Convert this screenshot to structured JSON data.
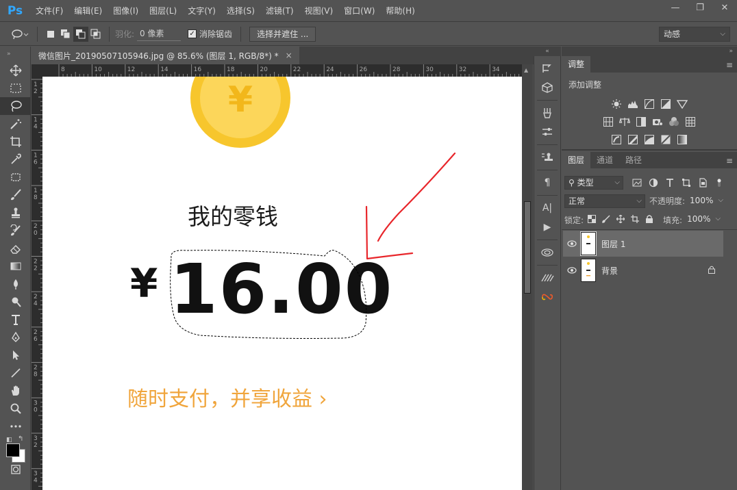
{
  "app": {
    "logo": "Ps",
    "menu": [
      "文件(F)",
      "编辑(E)",
      "图像(I)",
      "图层(L)",
      "文字(Y)",
      "选择(S)",
      "滤镜(T)",
      "视图(V)",
      "窗口(W)",
      "帮助(H)"
    ],
    "window_controls": {
      "minimize": "—",
      "restore": "❐",
      "close": "✕"
    }
  },
  "options": {
    "feather_label": "羽化:",
    "feather_value": "0 像素",
    "antialias_label": "消除锯齿",
    "antialias_checked": true,
    "select_mask_button": "选择并遮住 ...",
    "workspace": "动感"
  },
  "document": {
    "tab_title": "微信图片_20190507105946.jpg @ 85.6% (图层 1, RGB/8*) *",
    "tab_close": "×",
    "ruler_h": [
      "8",
      "10",
      "12",
      "14",
      "16",
      "18",
      "20",
      "22",
      "24",
      "26",
      "28",
      "30",
      "32",
      "34"
    ],
    "ruler_v": [
      "12",
      "14",
      "16",
      "18",
      "20",
      "22",
      "24",
      "26",
      "28",
      "30",
      "32",
      "34"
    ],
    "canvas": {
      "coin_symbol": "¥",
      "title": "我的零钱",
      "currency": "¥",
      "amount": "16.00",
      "promo": "随时支付，并享收益 ›"
    }
  },
  "adjustments": {
    "tab": "调整",
    "title": "添加调整",
    "icons_row1": [
      "brightness-contrast-icon",
      "levels-icon",
      "curves-icon",
      "exposure-icon",
      "vibrance-icon"
    ],
    "icons_row2": [
      "hue-saturation-icon",
      "color-balance-icon",
      "black-white-icon",
      "photo-filter-icon",
      "channel-mixer-icon",
      "color-lookup-icon"
    ],
    "icons_row3": [
      "invert-icon",
      "posterize-icon",
      "threshold-icon",
      "selective-color-icon",
      "gradient-map-icon"
    ]
  },
  "layers": {
    "tabs": [
      "图层",
      "通道",
      "路径"
    ],
    "filter_kind": "类型",
    "blend_mode": "正常",
    "opacity_label": "不透明度:",
    "opacity_value": "100%",
    "lock_label": "锁定:",
    "fill_label": "填充:",
    "fill_value": "100%",
    "items": [
      {
        "name": "图层 1",
        "selected": true,
        "locked": false
      },
      {
        "name": "背景",
        "selected": false,
        "locked": true
      }
    ]
  },
  "colors": {
    "accent_blue": "#31a8ff",
    "coin_outer": "#f7c62d",
    "coin_inner": "#fcd65a",
    "promo_orange": "#f0a53c",
    "annotation_red": "#e8262b"
  }
}
